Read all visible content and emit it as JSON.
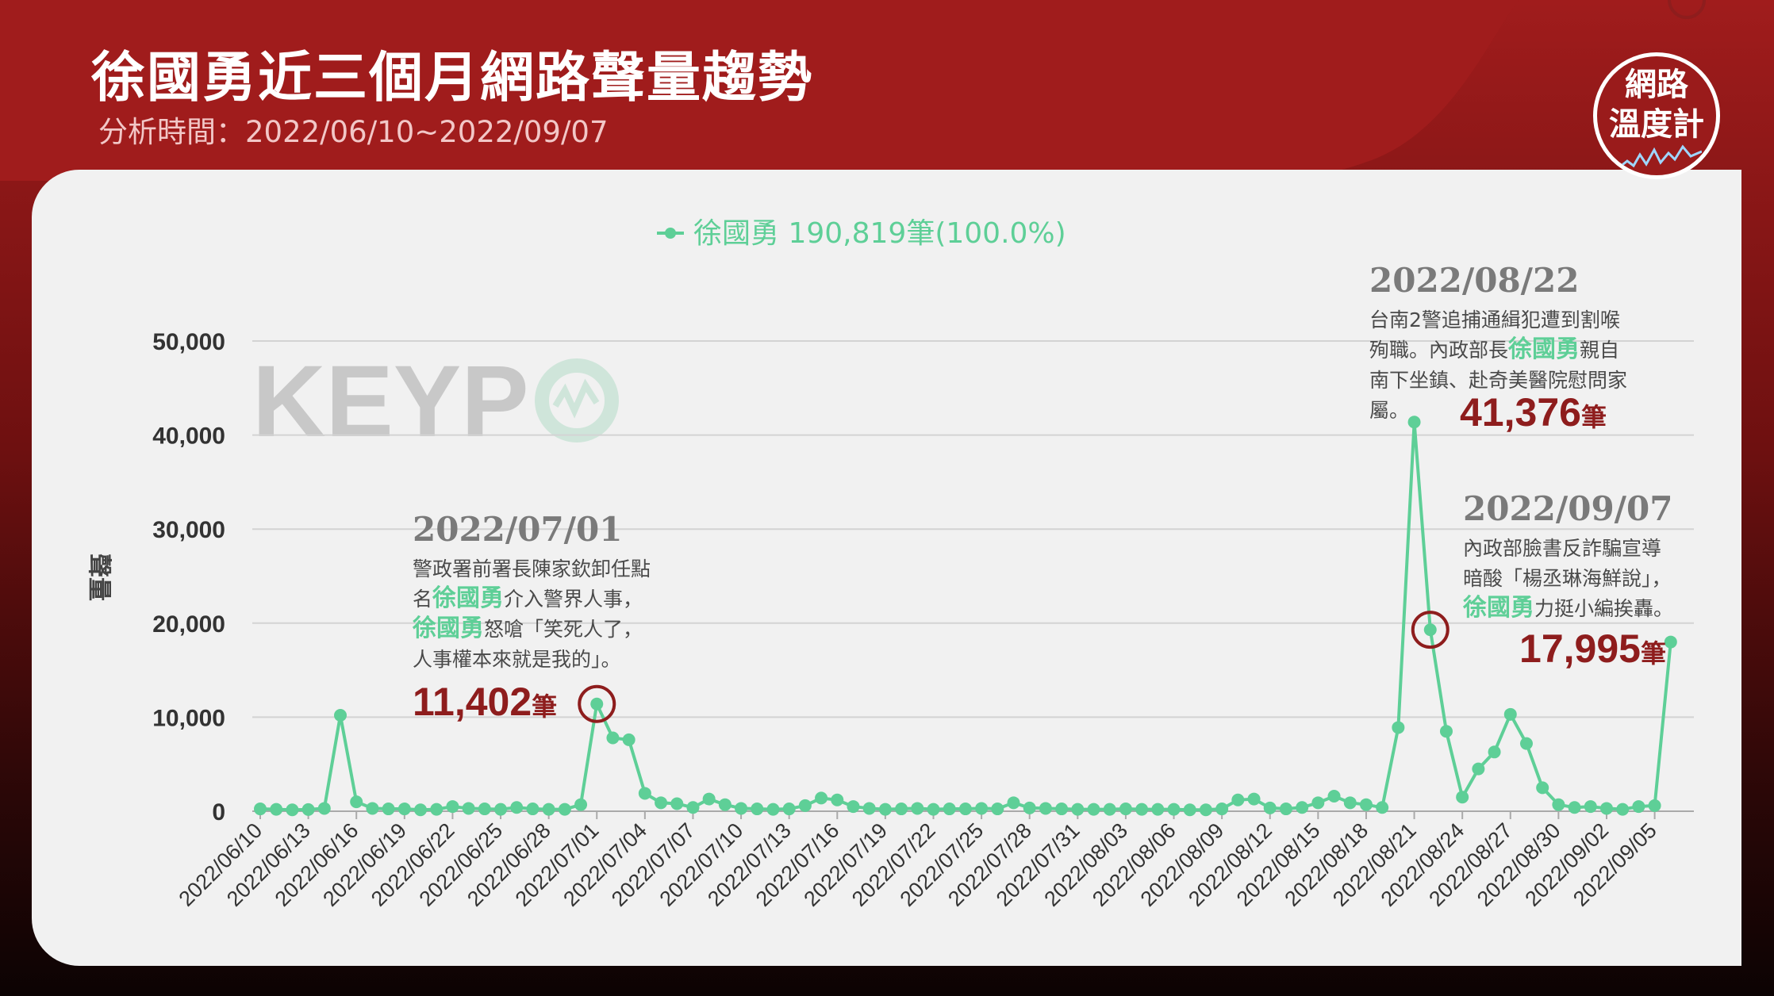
{
  "header": {
    "title": "徐國勇近三個月網路聲量趨勢",
    "subtitle": "分析時間：2022/06/10~2022/09/07"
  },
  "logo": {
    "line1": "網路",
    "line2": "溫度計"
  },
  "watermark": {
    "text": "KEYP"
  },
  "colors": {
    "series": "#5ecf97",
    "accent": "#8e1d1d",
    "header": "#a01c1c"
  },
  "chart_data": {
    "type": "line",
    "legend": {
      "label": "徐國勇 190,819筆(100.0%)",
      "placement": "top-center"
    },
    "ylabel": "聲量",
    "ylim": [
      0,
      50000
    ],
    "yticks": [
      "0",
      "10,000",
      "20,000",
      "30,000",
      "40,000",
      "50,000"
    ],
    "grid": true,
    "x_start": "2022-06-10",
    "x_end": "2022-09-07",
    "xtick_labels": [
      "2022/06/10",
      "2022/06/13",
      "2022/06/16",
      "2022/06/19",
      "2022/06/22",
      "2022/06/25",
      "2022/06/28",
      "2022/07/01",
      "2022/07/04",
      "2022/07/07",
      "2022/07/10",
      "2022/07/13",
      "2022/07/16",
      "2022/07/19",
      "2022/07/22",
      "2022/07/25",
      "2022/07/28",
      "2022/07/31",
      "2022/08/03",
      "2022/08/06",
      "2022/08/09",
      "2022/08/12",
      "2022/08/15",
      "2022/08/18",
      "2022/08/21",
      "2022/08/24",
      "2022/08/27",
      "2022/08/30",
      "2022/09/02",
      "2022/09/05"
    ],
    "series": [
      {
        "name": "徐國勇",
        "values": [
          250,
          200,
          150,
          180,
          300,
          10200,
          1000,
          300,
          250,
          250,
          150,
          200,
          500,
          300,
          250,
          200,
          400,
          250,
          200,
          200,
          700,
          11402,
          7800,
          7600,
          1900,
          900,
          800,
          400,
          1300,
          700,
          300,
          250,
          200,
          250,
          600,
          1400,
          1200,
          500,
          300,
          200,
          250,
          300,
          200,
          250,
          250,
          300,
          250,
          900,
          350,
          300,
          250,
          200,
          200,
          200,
          250,
          200,
          200,
          200,
          150,
          150,
          250,
          1200,
          1300,
          350,
          250,
          400,
          900,
          1600,
          900,
          700,
          400,
          8900,
          41376,
          19300,
          8500,
          1500,
          4500,
          6300,
          10300,
          7200,
          2500,
          700,
          400,
          500,
          300,
          200,
          500,
          600,
          17995
        ]
      }
    ],
    "annotations": [
      {
        "date": "2022/07/01",
        "lines": [
          [
            {
              "t": "警政署前署長陳家欽卸任點",
              "hl": false
            }
          ],
          [
            {
              "t": "名",
              "hl": false
            },
            {
              "t": "徐國勇",
              "hl": true
            },
            {
              "t": "介入警界人事，",
              "hl": false
            }
          ],
          [
            {
              "t": "徐國勇",
              "hl": true
            },
            {
              "t": "怒嗆「笑死人了，",
              "hl": false
            }
          ],
          [
            {
              "t": "人事權本來就是我的」。",
              "hl": false
            }
          ]
        ],
        "count": "11,402",
        "unit": "筆"
      },
      {
        "date": "2022/08/22",
        "lines": [
          [
            {
              "t": "台南2警追捕通緝犯遭到割喉",
              "hl": false
            }
          ],
          [
            {
              "t": "殉職。內政部長",
              "hl": false
            },
            {
              "t": "徐國勇",
              "hl": true
            },
            {
              "t": "親自",
              "hl": false
            }
          ],
          [
            {
              "t": "南下坐鎮、赴奇美醫院慰問家",
              "hl": false
            }
          ],
          [
            {
              "t": "屬。",
              "hl": false
            }
          ]
        ],
        "count": "41,376",
        "unit": "筆"
      },
      {
        "date": "2022/09/07",
        "lines": [
          [
            {
              "t": "內政部臉書反詐騙宣導",
              "hl": false
            }
          ],
          [
            {
              "t": "暗酸「楊丞琳海鮮說」，",
              "hl": false
            }
          ],
          [
            {
              "t": "徐國勇",
              "hl": true
            },
            {
              "t": "力挺小編挨轟。",
              "hl": false
            }
          ]
        ],
        "count": "17,995",
        "unit": "筆"
      }
    ]
  }
}
